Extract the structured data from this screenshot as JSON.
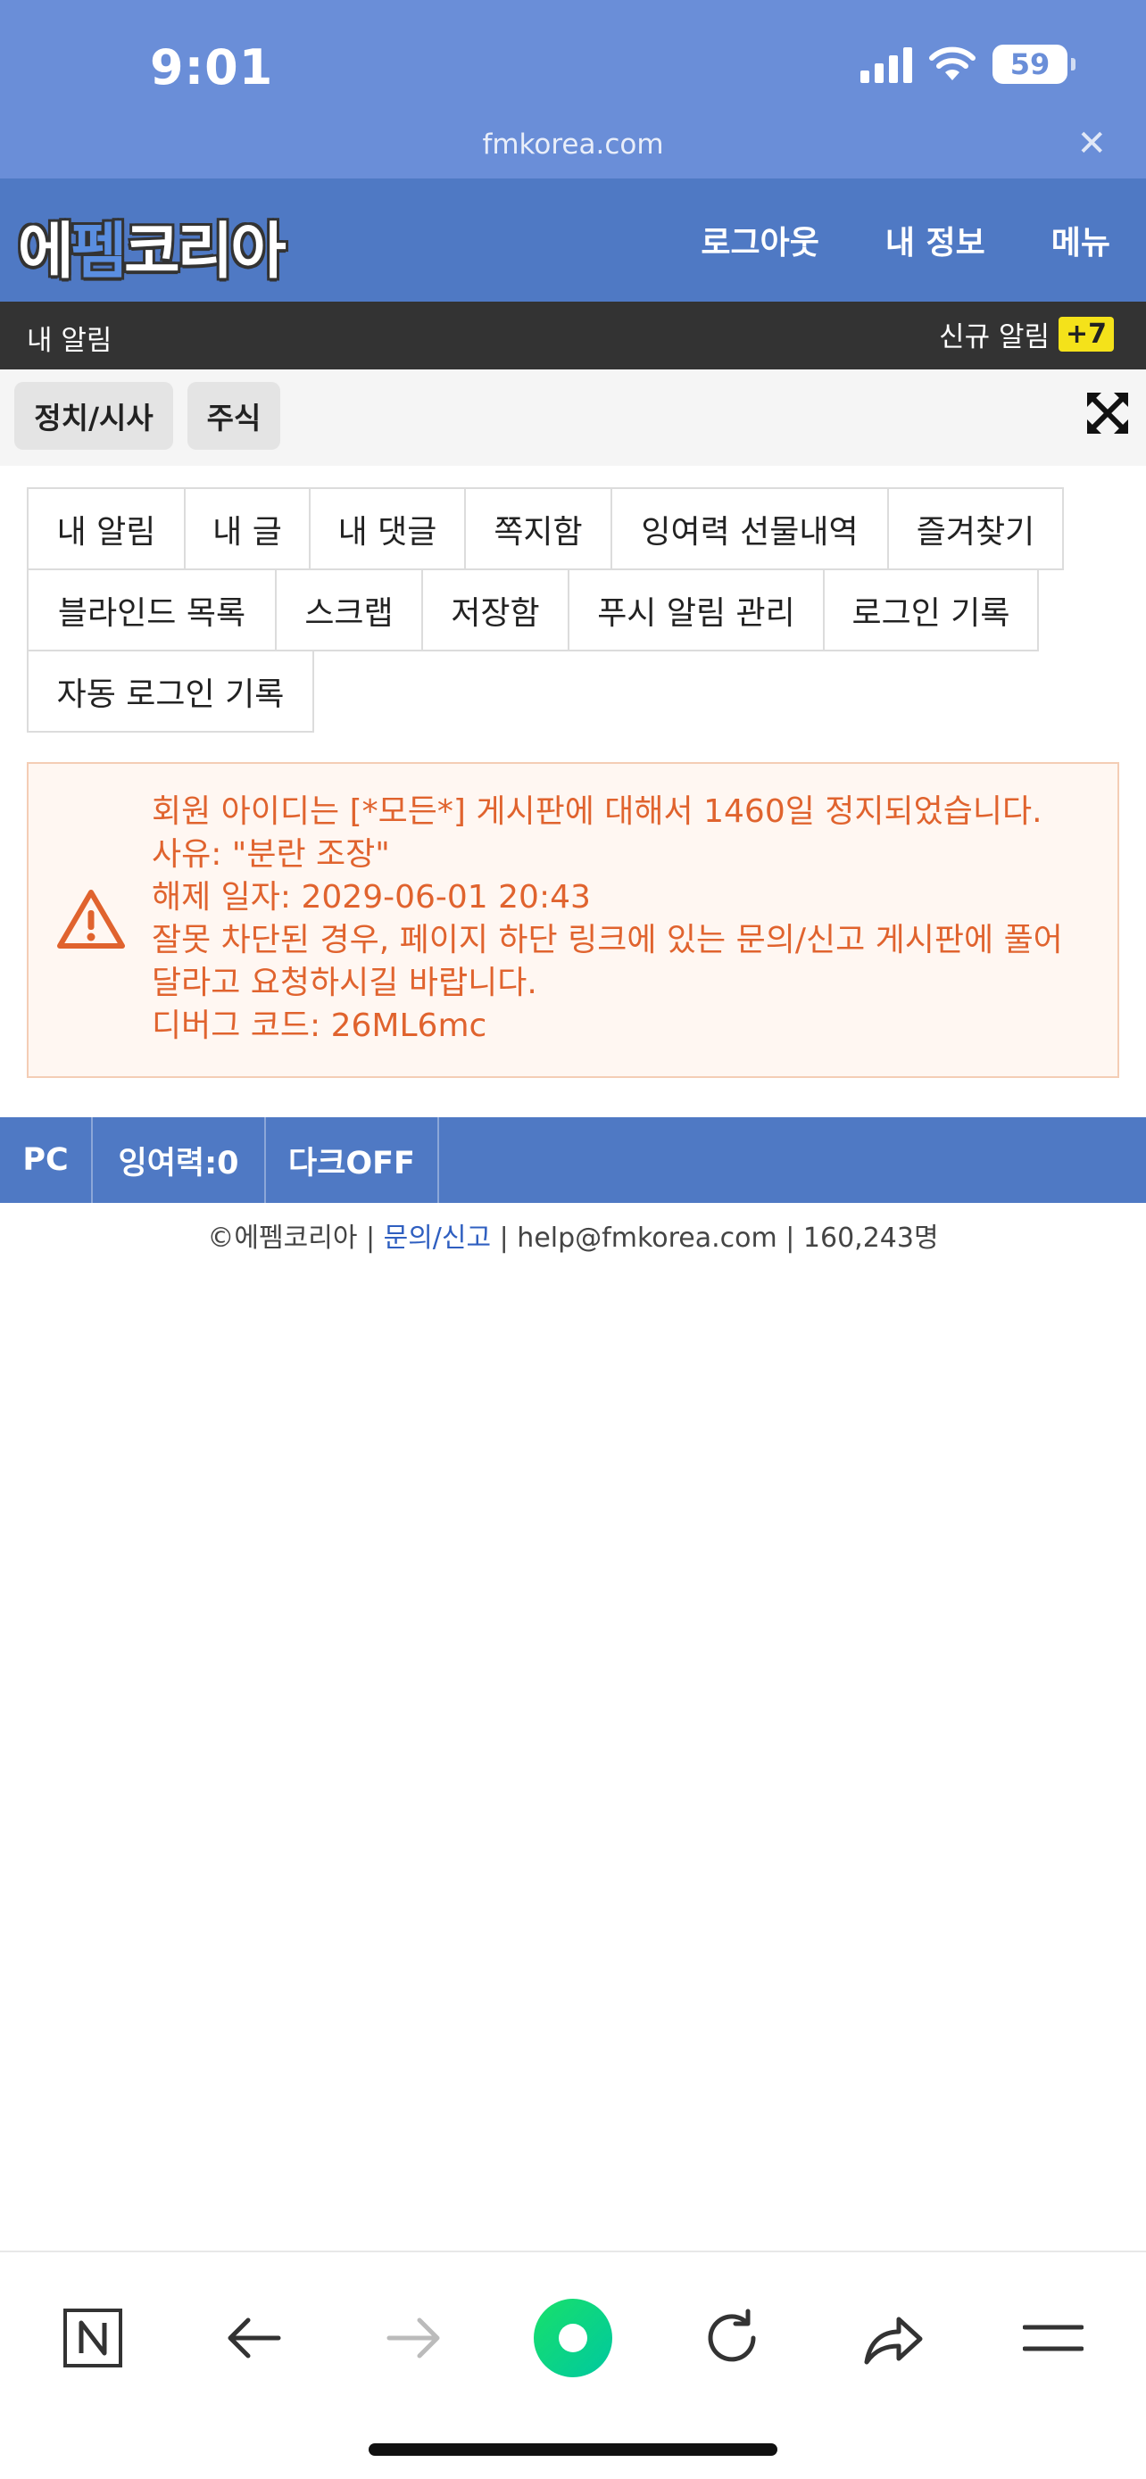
{
  "status_bar": {
    "time": "9:01",
    "battery": "59"
  },
  "url_bar": {
    "domain": "fmkorea.com"
  },
  "header": {
    "logo_part1": "에",
    "logo_part2": "펨",
    "logo_part3": "코리아",
    "nav": [
      "로그아웃",
      "내 정보",
      "메뉴"
    ]
  },
  "alert_bar": {
    "left_label": "내 알림",
    "right_label": "신규 알림",
    "badge": "+7"
  },
  "categories": [
    "정치/시사",
    "주식"
  ],
  "tabs": [
    "내 알림",
    "내 글",
    "내 댓글",
    "쪽지함",
    "잉여력 선물내역",
    "즐겨찾기",
    "블라인드 목록",
    "스크랩",
    "저장함",
    "푸시 알림 관리",
    "로그인 기록",
    "자동 로그인 기록"
  ],
  "warning": {
    "lines": [
      "회원 아이디는 [*모든*] 게시판에 대해서 1460일 정지되었습니다.",
      "사유: \"분란 조장\"",
      "해제 일자: 2029-06-01 20:43",
      "잘못 차단된 경우, 페이지 하단 링크에 있는 문의/신고 게시판에 풀어",
      "달라고 요청하시길 바랍니다.",
      "디버그 코드: 26ML6mc"
    ]
  },
  "footer_bar": {
    "items": [
      "PC",
      "잉여력:0",
      "다크OFF"
    ]
  },
  "copyright": {
    "prefix": "©에펨코리아 | ",
    "link": "문의/신고",
    "suffix": " | help@fmkorea.com | 160,243명"
  },
  "toolbar": {
    "icons": [
      "naver-n-icon",
      "back-icon",
      "forward-icon",
      "green-dot-icon",
      "reload-icon",
      "share-icon",
      "menu-icon"
    ]
  },
  "colors": {
    "top": "#6a8ed8",
    "header": "#4f79c4",
    "alert_bar": "#333333",
    "warning_text": "#e0632e"
  }
}
